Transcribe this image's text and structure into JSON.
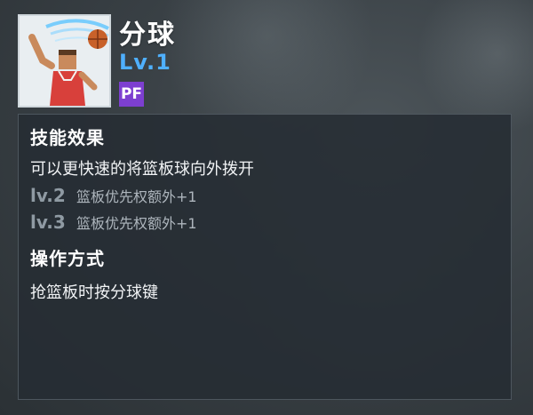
{
  "skill": {
    "name": "分球",
    "level": "Lv.1",
    "position": "PF"
  },
  "effect": {
    "heading": "技能效果",
    "description": "可以更快速的将篮板球向外拨开",
    "upgrades": [
      {
        "level": "lv.2",
        "text": "篮板优先权额外+1"
      },
      {
        "level": "lv.3",
        "text": "篮板优先权额外+1"
      }
    ]
  },
  "operation": {
    "heading": "操作方式",
    "description": "抢篮板时按分球键"
  },
  "colors": {
    "level_blue": "#4fb0ff",
    "position_purple": "#7d3fd0",
    "upgrade_gray": "#8f9aa3"
  },
  "icons": {
    "skill_art": "player-tipping-ball-illustration"
  }
}
